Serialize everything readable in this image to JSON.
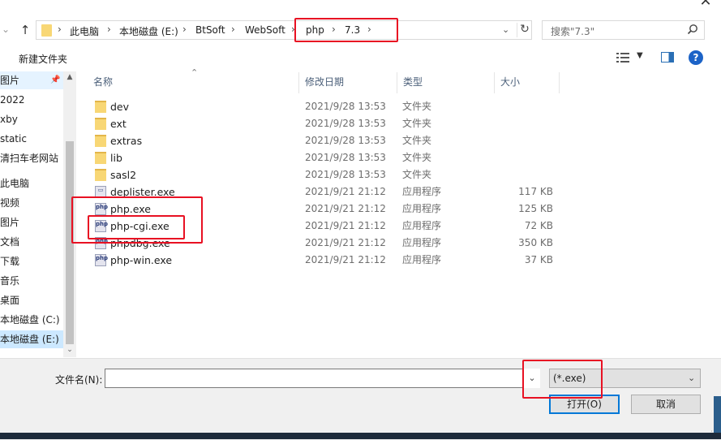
{
  "window": {
    "close_icon": "close-icon"
  },
  "address": {
    "crumbs": [
      "此电脑",
      "本地磁盘 (E:)",
      "BtSoft",
      "WebSoft",
      "php",
      "7.3"
    ],
    "separator": "›",
    "search_placeholder": "搜索\"7.3\""
  },
  "toolbar": {
    "new_folder": "新建文件夹"
  },
  "nav": {
    "items": [
      "图片",
      "2022",
      "xby",
      "static",
      "清扫车老网站",
      "此电脑",
      "视频",
      "图片",
      "文档",
      "下载",
      "音乐",
      "桌面",
      "本地磁盘 (C:)",
      "本地磁盘 (E:)"
    ]
  },
  "columns": {
    "name": "名称",
    "date": "修改日期",
    "type": "类型",
    "size": "大小"
  },
  "files": [
    {
      "name": "dev",
      "date": "2021/9/28 13:53",
      "type": "文件夹",
      "size": "",
      "kind": "folder"
    },
    {
      "name": "ext",
      "date": "2021/9/28 13:53",
      "type": "文件夹",
      "size": "",
      "kind": "folder"
    },
    {
      "name": "extras",
      "date": "2021/9/28 13:53",
      "type": "文件夹",
      "size": "",
      "kind": "folder"
    },
    {
      "name": "lib",
      "date": "2021/9/28 13:53",
      "type": "文件夹",
      "size": "",
      "kind": "folder"
    },
    {
      "name": "sasl2",
      "date": "2021/9/28 13:53",
      "type": "文件夹",
      "size": "",
      "kind": "folder"
    },
    {
      "name": "deplister.exe",
      "date": "2021/9/21 21:12",
      "type": "应用程序",
      "size": "117 KB",
      "kind": "exe"
    },
    {
      "name": "php.exe",
      "date": "2021/9/21 21:12",
      "type": "应用程序",
      "size": "125 KB",
      "kind": "php"
    },
    {
      "name": "php-cgi.exe",
      "date": "2021/9/21 21:12",
      "type": "应用程序",
      "size": "72 KB",
      "kind": "php"
    },
    {
      "name": "phpdbg.exe",
      "date": "2021/9/21 21:12",
      "type": "应用程序",
      "size": "350 KB",
      "kind": "php"
    },
    {
      "name": "php-win.exe",
      "date": "2021/9/21 21:12",
      "type": "应用程序",
      "size": "37 KB",
      "kind": "php"
    }
  ],
  "php_badge": "php",
  "bottom": {
    "filename_label": "文件名(N):",
    "filename_value": "",
    "filter_value": "(*.exe)",
    "open_button": "打开(O)",
    "cancel_button": "取消"
  },
  "colors": {
    "highlight": "#e81123",
    "accent": "#0078d7",
    "selection": "#cce8ff"
  }
}
